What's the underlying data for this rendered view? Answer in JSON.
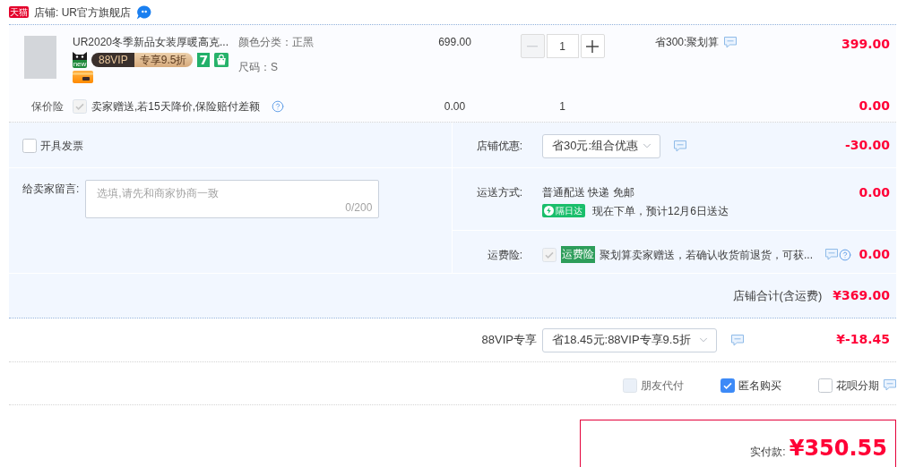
{
  "shop": {
    "logo": "天猫",
    "title": "店铺: UR官方旗舰店"
  },
  "item": {
    "title": "UR2020冬季新品女装厚暖高克...",
    "badges": [
      {
        "kind": "new",
        "text": "new"
      },
      {
        "kind": "vip",
        "text": "88VIP",
        "discount": "专享9.5折"
      },
      {
        "kind": "return",
        "text": "7"
      },
      {
        "kind": "bag"
      }
    ],
    "extra_badges": [
      {
        "kind": "card"
      }
    ],
    "attributes": [
      "颜色分类：正黑",
      "尺码：S"
    ],
    "unit_price": "699.00",
    "quantity": "1",
    "minus_disabled": true,
    "promotion": "省300:聚划算",
    "subtotal": "399.00"
  },
  "insurance": {
    "label": "保价险",
    "checked": true,
    "disabled": true,
    "text": "卖家赠送,若15天降价,保险赔付差额",
    "price": "0.00",
    "quantity": "1",
    "subtotal": "0.00"
  },
  "invoice": {
    "label": "开具发票",
    "checked": false
  },
  "message": {
    "label": "给卖家留言:",
    "placeholder": "选填,请先和商家协商一致",
    "counter": "0/200"
  },
  "shop_discount": {
    "label": "店铺优惠:",
    "value": "省30元:组合优惠",
    "amount": "-30.00"
  },
  "shipping": {
    "label": "运送方式:",
    "method": "普通配送 快递 免邮",
    "badge": "隔日达",
    "eta": "现在下单，预计12月6日送达",
    "amount": "0.00"
  },
  "freight_insurance": {
    "label": "运费险:",
    "checked": true,
    "disabled": true,
    "tag": "运费险",
    "text": "聚划算卖家赠送，若确认收货前退货，可获...",
    "amount": "0.00"
  },
  "shop_total": {
    "label": "店铺合计(含运费)",
    "amount": "¥369.00"
  },
  "vip_discount": {
    "label": "88VIP专享",
    "value": "省18.45元:88VIP专享9.5折",
    "amount": "¥-18.45"
  },
  "options": [
    {
      "label": "朋友代付",
      "checked": false,
      "disabled": true
    },
    {
      "label": "匿名购买",
      "checked": true,
      "disabled": false
    },
    {
      "label": "花呗分期",
      "checked": false,
      "disabled": false
    }
  ],
  "payment": {
    "label": "实付款:",
    "amount": "¥350.55"
  }
}
